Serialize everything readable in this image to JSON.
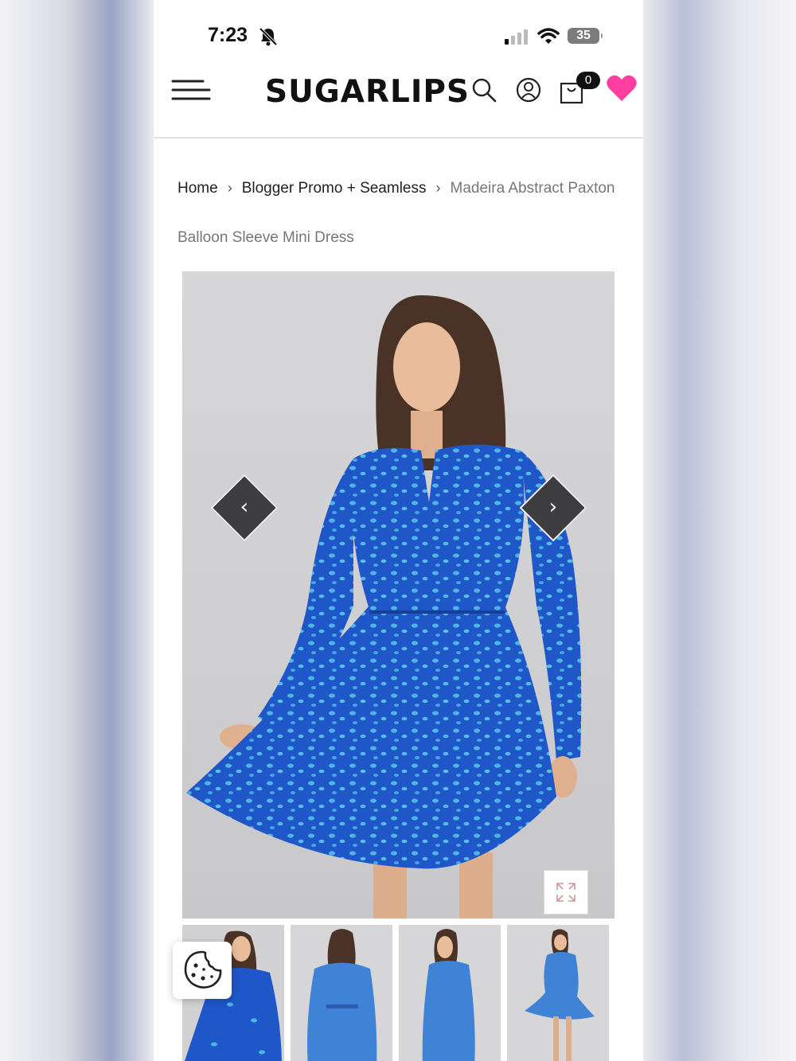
{
  "status_bar": {
    "time": "7:23",
    "battery": "35",
    "icons": [
      "bell-slash-icon",
      "signal-icon",
      "wifi-icon",
      "battery-icon"
    ]
  },
  "header": {
    "logo": "SUGARLIPS",
    "cart_count": "0",
    "icons": [
      "menu-icon",
      "search-icon",
      "account-icon",
      "cart-icon",
      "heart-icon"
    ],
    "heart_color": "#ff3fa0"
  },
  "breadcrumb": {
    "items": [
      "Home",
      "Blogger Promo + Seamless"
    ],
    "current": "Madeira Abstract Paxton Balloon Sleeve Mini Dress",
    "separator": "›"
  },
  "gallery": {
    "prev_label": "‹",
    "next_label": "›",
    "dress_color": "#1f56c8",
    "spot_color": "#4fb4e6",
    "thumbnail_count": 4
  }
}
